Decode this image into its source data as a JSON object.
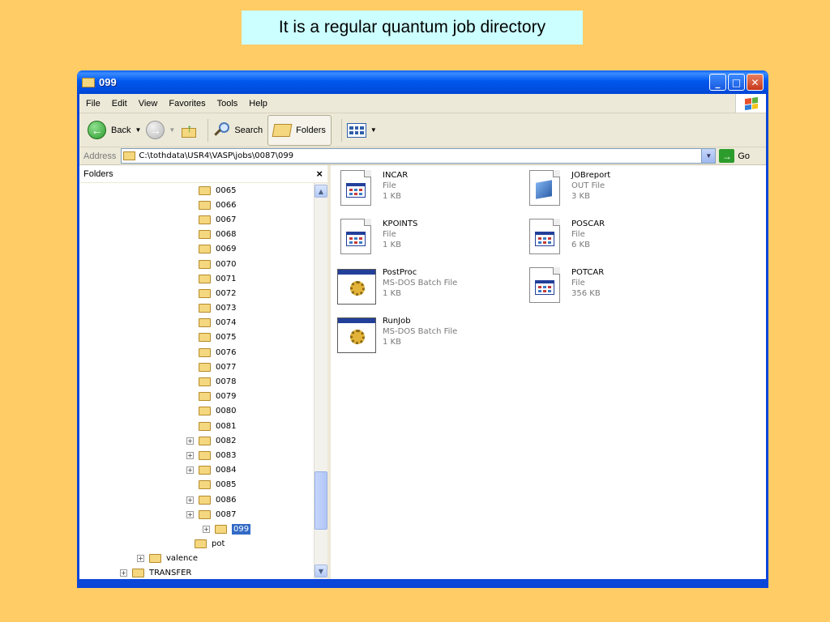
{
  "slide_title": "It is a regular quantum job directory",
  "window": {
    "title": "099",
    "minimize": "_",
    "maximize": "□",
    "close": "✕"
  },
  "menu": [
    "File",
    "Edit",
    "View",
    "Favorites",
    "Tools",
    "Help"
  ],
  "toolbar": {
    "back": "Back",
    "search": "Search",
    "folders": "Folders"
  },
  "address": {
    "label": "Address",
    "path": "C:\\tothdata\\USR4\\VASP\\jobs\\0087\\099",
    "go": "Go"
  },
  "folders_pane": {
    "title": "Folders",
    "close": "×",
    "tree": [
      {
        "label": "0065",
        "expander": false
      },
      {
        "label": "0066",
        "expander": false
      },
      {
        "label": "0067",
        "expander": false
      },
      {
        "label": "0068",
        "expander": false
      },
      {
        "label": "0069",
        "expander": false
      },
      {
        "label": "0070",
        "expander": false
      },
      {
        "label": "0071",
        "expander": false
      },
      {
        "label": "0072",
        "expander": false
      },
      {
        "label": "0073",
        "expander": false
      },
      {
        "label": "0074",
        "expander": false
      },
      {
        "label": "0075",
        "expander": false
      },
      {
        "label": "0076",
        "expander": false
      },
      {
        "label": "0077",
        "expander": false
      },
      {
        "label": "0078",
        "expander": false
      },
      {
        "label": "0079",
        "expander": false
      },
      {
        "label": "0080",
        "expander": false
      },
      {
        "label": "0081",
        "expander": false
      },
      {
        "label": "0082",
        "expander": true
      },
      {
        "label": "0083",
        "expander": true
      },
      {
        "label": "0084",
        "expander": true
      },
      {
        "label": "0085",
        "expander": false
      },
      {
        "label": "0086",
        "expander": true
      },
      {
        "label": "0087",
        "expander": true
      },
      {
        "label": "099",
        "expander": true,
        "selected": true
      },
      {
        "label": "pot",
        "expander": false
      },
      {
        "label": "valence",
        "expander": true
      },
      {
        "label": "TRANSFER",
        "expander": true
      }
    ]
  },
  "files": [
    {
      "name": "INCAR",
      "type": "File",
      "size": "1 KB",
      "icon": "text-file-icon"
    },
    {
      "name": "JOBreport",
      "type": "OUT File",
      "size": "3 KB",
      "icon": "generic-file-icon"
    },
    {
      "name": "KPOINTS",
      "type": "File",
      "size": "1 KB",
      "icon": "text-file-icon"
    },
    {
      "name": "POSCAR",
      "type": "File",
      "size": "6 KB",
      "icon": "text-file-icon"
    },
    {
      "name": "PostProc",
      "type": "MS-DOS Batch File",
      "size": "1 KB",
      "icon": "batch-file-icon"
    },
    {
      "name": "POTCAR",
      "type": "File",
      "size": "356 KB",
      "icon": "text-file-icon"
    },
    {
      "name": "RunJob",
      "type": "MS-DOS Batch File",
      "size": "1 KB",
      "icon": "batch-file-icon"
    }
  ]
}
